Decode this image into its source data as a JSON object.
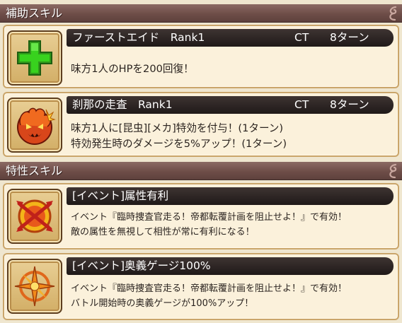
{
  "support_section": {
    "title": "補助スキル"
  },
  "support_skills": [
    {
      "name": "ファーストエイド　Rank1",
      "ct_label": "CT",
      "turns": "8ターン",
      "lines": [
        "味方1人のHPを200回復！"
      ],
      "icon": "green-cross-icon"
    },
    {
      "name": "刹那の走査　Rank1",
      "ct_label": "CT",
      "turns": "8ターン",
      "lines": [
        "味方1人に[昆虫][メカ]特効を付与！(1ターン)",
        "特効発生時のダメージを5%アップ！(1ターン)"
      ],
      "icon": "fire-demon-icon"
    }
  ],
  "trait_section": {
    "title": "特性スキル"
  },
  "trait_skills": [
    {
      "name": "[イベント]属性有利",
      "lines": [
        "イベント『臨時捜査官走る！帝都転覆計画を阻止せよ！』で有効！",
        "敵の属性を無視して相性が常に有利になる！"
      ],
      "icon": "broken-arrow-emblem-icon"
    },
    {
      "name": "[イベント]奥義ゲージ100%",
      "lines": [
        "イベント『臨時捜査官走る！帝都転覆計画を阻止せよ！』で有効！",
        "バトル開始時の奥義ゲージが100%アップ！"
      ],
      "icon": "compass-star-emblem-icon"
    }
  ],
  "colors": {
    "section_bar": "#6e4d48",
    "card_bg": "#fbf1db",
    "card_border": "#caa56a",
    "name_bar": "#2a2220"
  }
}
